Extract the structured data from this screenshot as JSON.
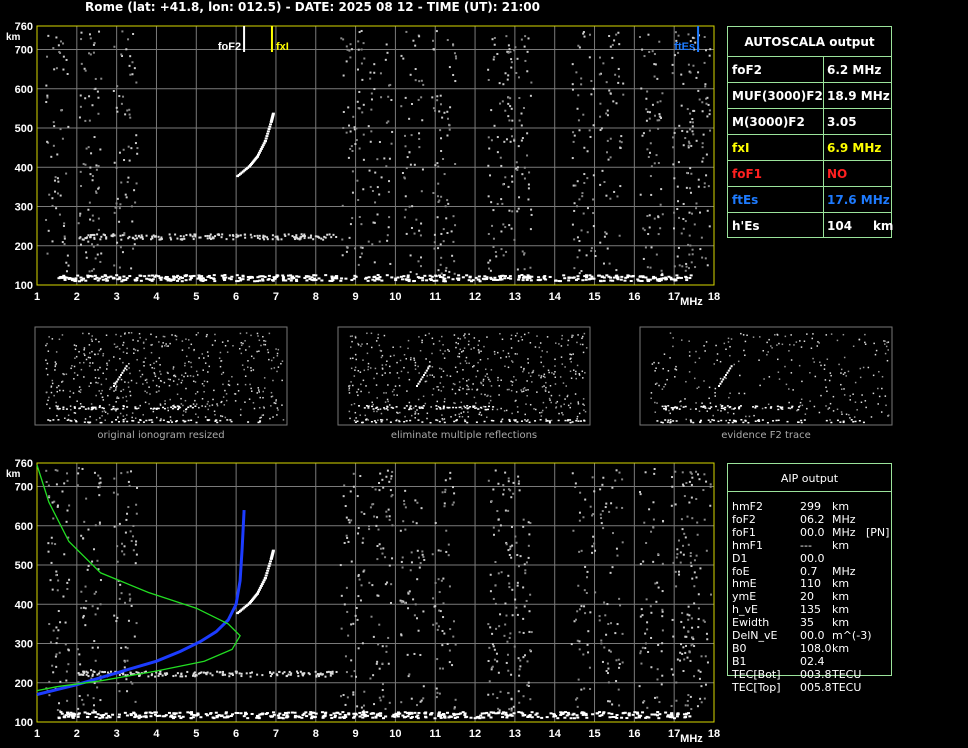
{
  "header": "Rome (lat: +41.8, lon: 012.5) - DATE: 2025 08 12 - TIME (UT): 21:00",
  "colors": {
    "grid": "#7a7a7a",
    "axis": "#d8d800",
    "accent_green": "#9be39b",
    "foF2": "#ffffff",
    "fxI": "#ffff00",
    "ftEs": "#1e7bff",
    "profile_blue": "#1c3cff",
    "profile_green": "#22dd22",
    "foF1": "#ff2020"
  },
  "axis": {
    "y_ticks": [
      "100",
      "200",
      "300",
      "400",
      "500",
      "600",
      "700",
      "760"
    ],
    "y_unit": "km",
    "x_ticks": [
      "1",
      "2",
      "3",
      "4",
      "5",
      "6",
      "7",
      "8",
      "9",
      "10",
      "11",
      "12",
      "13",
      "14",
      "15",
      "16",
      "17",
      "18"
    ],
    "x_unit": "MHz"
  },
  "markers": {
    "foF2_label": "foF2",
    "fxI_label": "fxI",
    "ftEs_label": "ftEs"
  },
  "autoscala": {
    "title": "AUTOSCALA output",
    "rows": [
      {
        "label": "foF2",
        "value": "6.2 MHz",
        "color": "#ffffff"
      },
      {
        "label": "MUF(3000)F2",
        "value": "18.9 MHz",
        "color": "#ffffff"
      },
      {
        "label": "M(3000)F2",
        "value": "3.05",
        "color": "#ffffff"
      },
      {
        "label": "fxI",
        "value": "6.9 MHz",
        "color": "#ffff00"
      },
      {
        "label": "foF1",
        "value": "NO",
        "color": "#ff2020"
      },
      {
        "label": "ftEs",
        "value": "17.6 MHz",
        "color": "#1e7bff"
      },
      {
        "label": "h'Es",
        "value": "104     km",
        "color": "#ffffff"
      }
    ]
  },
  "thumbnails": [
    "original ionogram resized",
    "eliminate multiple reflections",
    "evidence F2 trace"
  ],
  "aip": {
    "title": "AIP output",
    "rows": [
      [
        "hmF2",
        "299",
        "km",
        ""
      ],
      [
        "foF2",
        "06.2",
        "MHz",
        ""
      ],
      [
        "foF1",
        "00.0",
        "MHz",
        "[PN]"
      ],
      [
        "hmF1",
        "---",
        "km",
        ""
      ],
      [
        "D1",
        "00.0",
        "",
        ""
      ],
      [
        "foE",
        "0.7",
        "MHz",
        ""
      ],
      [
        "hmE",
        "110",
        "km",
        ""
      ],
      [
        "ymE",
        "20",
        "km",
        ""
      ],
      [
        "h_vE",
        "135",
        "km",
        ""
      ],
      [
        "Ewidth",
        "35",
        "km",
        ""
      ],
      [
        "DelN_vE",
        "00.0",
        "m^(-3)",
        ""
      ],
      [
        "B0",
        "108.0",
        "km",
        ""
      ],
      [
        "B1",
        "02.4",
        "",
        ""
      ],
      [
        "TEC[Bot]",
        "003.8",
        "TECU",
        ""
      ],
      [
        "TEC[Top]",
        "005.8",
        "TECU",
        ""
      ]
    ]
  },
  "chart_data": [
    {
      "type": "scatter",
      "title": "",
      "xlabel": "MHz",
      "ylabel": "km",
      "xlim": [
        1,
        18
      ],
      "ylim": [
        100,
        760
      ],
      "series": [
        {
          "name": "",
          "points": [
            [
              6.0,
              380
            ],
            [
              6.3,
              405
            ],
            [
              6.5,
              430
            ],
            [
              6.7,
              470
            ],
            [
              6.85,
              520
            ],
            [
              6.9,
              540
            ]
          ]
        }
      ],
      "markers": {
        "foF2": 6.2,
        "fxI": 6.9,
        "ftEs": 17.6
      }
    },
    {
      "type": "line",
      "title": "",
      "xlabel": "MHz",
      "ylabel": "km",
      "xlim": [
        1,
        18
      ],
      "ylim": [
        100,
        760
      ],
      "series": [
        {
          "name": "",
          "points": [
            [
              1.0,
              170
            ],
            [
              2.0,
              195
            ],
            [
              3.0,
              225
            ],
            [
              4.0,
              255
            ],
            [
              4.6,
              280
            ],
            [
              5.1,
              305
            ],
            [
              5.5,
              330
            ],
            [
              5.8,
              360
            ],
            [
              6.0,
              400
            ],
            [
              6.1,
              460
            ],
            [
              6.15,
              540
            ],
            [
              6.2,
              640
            ]
          ]
        },
        {
          "name": "",
          "points": [
            [
              1.0,
              755
            ],
            [
              1.3,
              660
            ],
            [
              1.8,
              560
            ],
            [
              2.6,
              480
            ],
            [
              3.8,
              430
            ],
            [
              5.0,
              390
            ],
            [
              5.8,
              350
            ],
            [
              6.1,
              320
            ],
            [
              5.9,
              285
            ],
            [
              5.2,
              255
            ],
            [
              4.0,
              230
            ],
            [
              2.6,
              205
            ],
            [
              1.5,
              190
            ],
            [
              1.0,
              180
            ]
          ]
        }
      ]
    }
  ]
}
